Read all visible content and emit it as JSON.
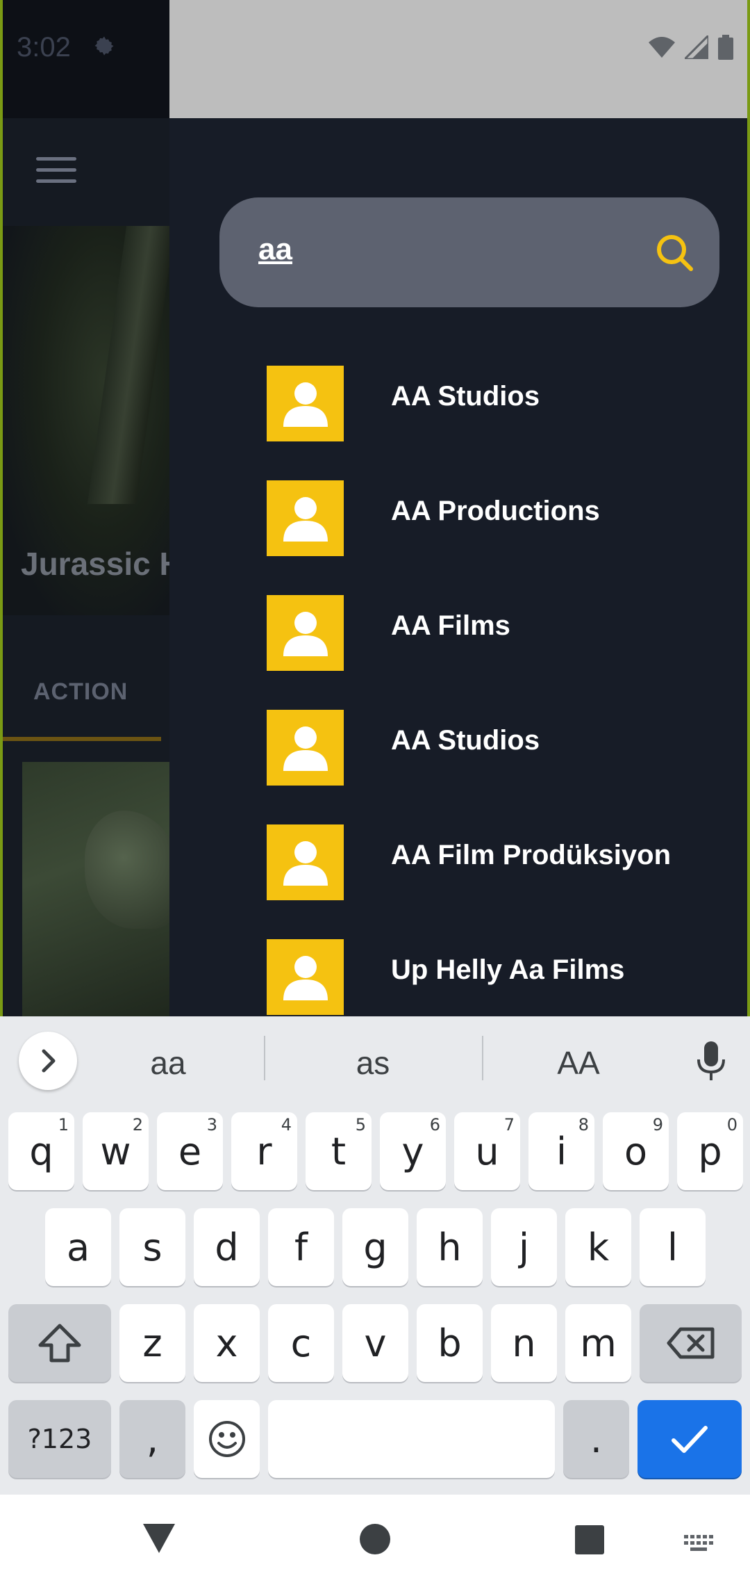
{
  "status_bar": {
    "time": "3:02"
  },
  "background_app": {
    "movie_title": "Jurassic H",
    "tab_label": "ACTION"
  },
  "search": {
    "query": "aa"
  },
  "results": [
    {
      "label": "AA Studios"
    },
    {
      "label": "AA Productions"
    },
    {
      "label": "AA Films"
    },
    {
      "label": "AA Studios"
    },
    {
      "label": "AA Film Prodüksiyon"
    },
    {
      "label": "Up Helly Aa Films"
    }
  ],
  "keyboard": {
    "suggestions": [
      "aa",
      "as",
      "AA"
    ],
    "row1": [
      {
        "key": "q",
        "hint": "1"
      },
      {
        "key": "w",
        "hint": "2"
      },
      {
        "key": "e",
        "hint": "3"
      },
      {
        "key": "r",
        "hint": "4"
      },
      {
        "key": "t",
        "hint": "5"
      },
      {
        "key": "y",
        "hint": "6"
      },
      {
        "key": "u",
        "hint": "7"
      },
      {
        "key": "i",
        "hint": "8"
      },
      {
        "key": "o",
        "hint": "9"
      },
      {
        "key": "p",
        "hint": "0"
      }
    ],
    "row2": [
      "a",
      "s",
      "d",
      "f",
      "g",
      "h",
      "j",
      "k",
      "l"
    ],
    "row3": [
      "z",
      "x",
      "c",
      "v",
      "b",
      "n",
      "m"
    ],
    "symbols_label": "?123",
    "comma_label": ",",
    "period_label": "."
  },
  "colors": {
    "drawer_bg": "#171c27",
    "search_bg": "#5d6270",
    "accent_yellow": "#f5c211",
    "keyboard_action": "#1a73e8"
  },
  "icons": {
    "search": "search-icon",
    "avatar": "person-icon",
    "menu": "menu-icon",
    "mic": "mic-icon",
    "shift": "shift-icon",
    "backspace": "backspace-icon",
    "emoji": "emoji-icon",
    "enter": "check-icon"
  }
}
